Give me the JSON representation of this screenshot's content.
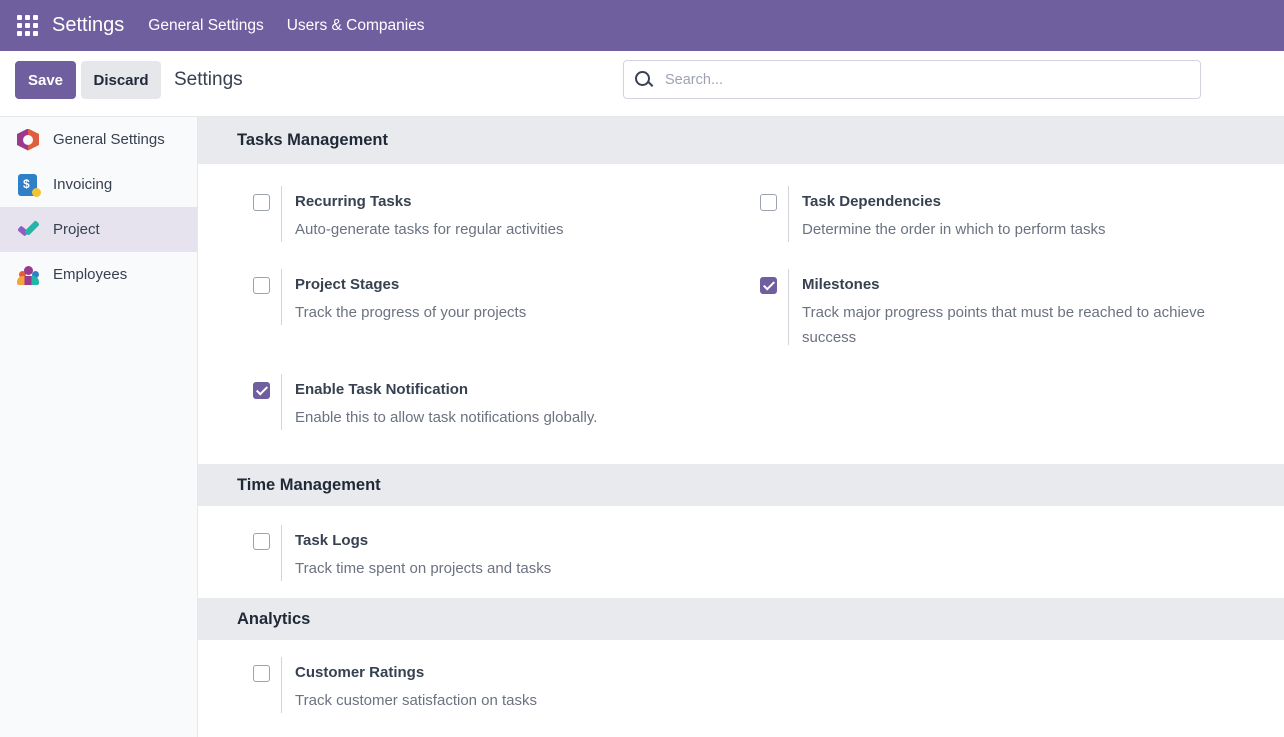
{
  "navbar": {
    "brand": "Settings",
    "menu": [
      "General Settings",
      "Users & Companies"
    ]
  },
  "control": {
    "save_label": "Save",
    "discard_label": "Discard",
    "breadcrumb": "Settings",
    "search_placeholder": "Search..."
  },
  "sidebar": {
    "items": [
      {
        "label": "General Settings",
        "icon": "general-settings-icon"
      },
      {
        "label": "Invoicing",
        "icon": "invoicing-icon"
      },
      {
        "label": "Project",
        "icon": "project-icon",
        "active": true
      },
      {
        "label": "Employees",
        "icon": "employees-icon"
      }
    ]
  },
  "sections": {
    "tasks": {
      "title": "Tasks Management",
      "recurring": {
        "title": "Recurring Tasks",
        "desc": "Auto-generate tasks for regular activities",
        "checked": false
      },
      "dependencies": {
        "title": "Task Dependencies",
        "desc": "Determine the order in which to perform tasks",
        "checked": false
      },
      "stages": {
        "title": "Project Stages",
        "desc": "Track the progress of your projects",
        "checked": false
      },
      "milestones": {
        "title": "Milestones",
        "desc": "Track major progress points that must be reached to achieve success",
        "checked": true
      },
      "notification": {
        "title": "Enable Task Notification",
        "desc": "Enable this to allow task notifications globally.",
        "checked": true
      }
    },
    "time": {
      "title": "Time Management",
      "logs": {
        "title": "Task Logs",
        "desc": "Track time spent on projects and tasks",
        "checked": false
      }
    },
    "analytics": {
      "title": "Analytics",
      "ratings": {
        "title": "Customer Ratings",
        "desc": "Track customer satisfaction on tasks",
        "checked": false
      }
    }
  },
  "colors": {
    "primary": "#6f5f9e",
    "section_bg": "#e9eaed",
    "sidebar_active": "#e6e3ee"
  }
}
